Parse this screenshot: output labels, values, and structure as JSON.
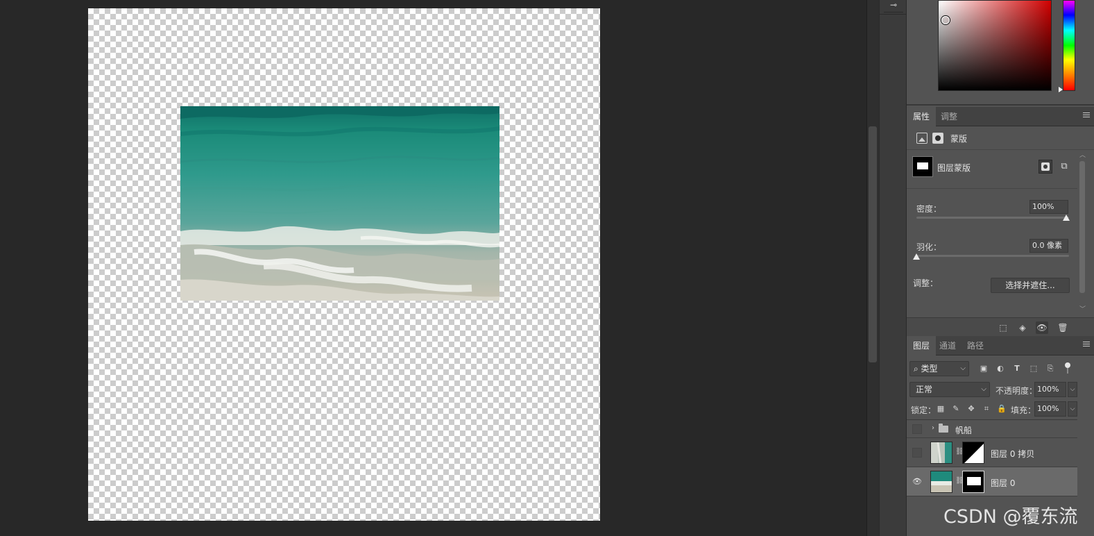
{
  "properties_panel": {
    "tabs": [
      {
        "label": "属性",
        "active": true
      },
      {
        "label": "调整",
        "active": false
      }
    ],
    "mode_label": "蒙版",
    "layer_mask_label": "图层蒙版",
    "density": {
      "label": "密度：",
      "value": "100%",
      "fraction": 1.0
    },
    "feather": {
      "label": "羽化：",
      "value": "0.0 像素",
      "fraction": 0.0
    },
    "refine": {
      "label": "调整：",
      "button_label": "选择并遮住..."
    }
  },
  "layers_panel": {
    "tabs": [
      {
        "label": "图层",
        "active": true
      },
      {
        "label": "通道",
        "active": false
      },
      {
        "label": "路径",
        "active": false
      }
    ],
    "filter_kind": "类型",
    "blend_mode": "正常",
    "opacity": {
      "label": "不透明度：",
      "value": "100%"
    },
    "lock_label": "锁定：",
    "fill": {
      "label": "填充：",
      "value": "100%"
    },
    "layers": [
      {
        "name": "帆船",
        "type": "group",
        "visible": false,
        "selected": false
      },
      {
        "name": "图层 0 拷贝",
        "type": "layer",
        "visible": false,
        "selected": false
      },
      {
        "name": "图层 0",
        "type": "layer",
        "visible": true,
        "selected": true
      }
    ]
  },
  "icons": {
    "dock_tool": "properties-slider-icon",
    "image_mode": "image-icon",
    "mask_mode": "mask-icon",
    "select_mask": "select-mask-icon",
    "add_vector_mask": "add-vector-mask-icon",
    "footer": [
      "load-selection-icon",
      "apply-mask-icon",
      "toggle-mask-visibility-icon",
      "delete-mask-icon"
    ],
    "filters": [
      "pixel-filter-icon",
      "adjustment-filter-icon",
      "type-filter-icon",
      "shape-filter-icon",
      "smart-object-filter-icon"
    ],
    "locks": [
      "lock-transparent-pixels-icon",
      "lock-image-pixels-icon",
      "lock-position-icon",
      "lock-artboard-icon",
      "lock-all-icon"
    ]
  },
  "colors": {
    "panel_bg": "#535353",
    "canvas_bg": "#282828",
    "selected_layer": "#6a6a6a",
    "foreground_hue": "#d10000",
    "ocean_teal": "#1e8a7e"
  },
  "watermark": "CSDN @覆东流"
}
